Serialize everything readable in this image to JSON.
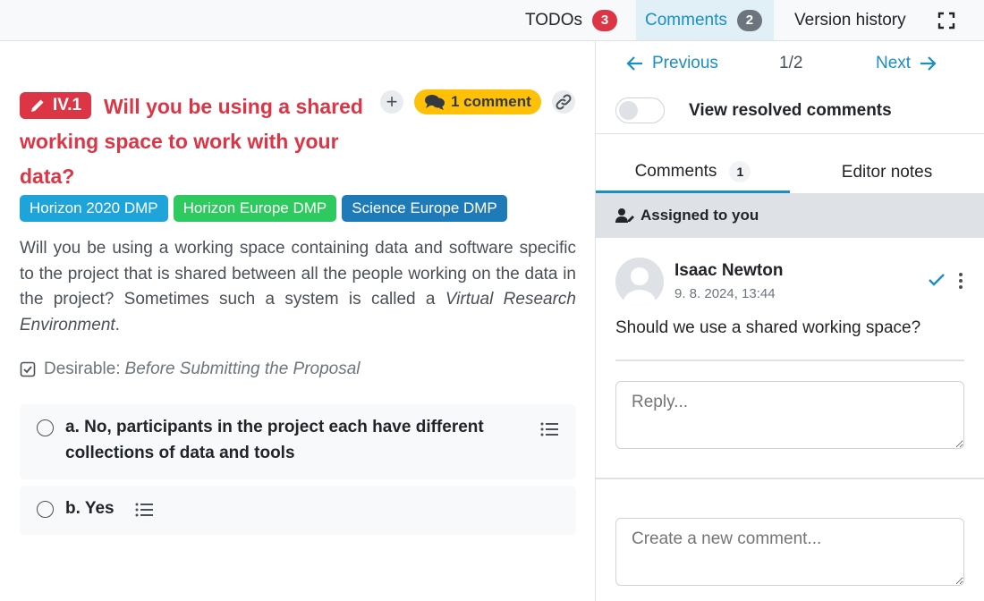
{
  "topbar": {
    "todos_label": "TODOs",
    "todos_count": "3",
    "comments_label": "Comments",
    "comments_count": "2",
    "version_history_label": "Version history",
    "fullscreen_icon": "fullscreen-icon"
  },
  "question": {
    "tag": "IV.1",
    "title": "Will you be using a shared working space to work with your data?",
    "comment_pill": "1 comment",
    "tags": [
      {
        "label": "Horizon 2020 DMP",
        "color": "#1ea4d9"
      },
      {
        "label": "Horizon Europe DMP",
        "color": "#2ec95f"
      },
      {
        "label": "Science Europe DMP",
        "color": "#1f7bb8"
      }
    ],
    "description_main": "Will you be using a working space containing data and software specific to the project that is shared between all the people working on the data in the project? Sometimes such a system is called a ",
    "description_em": "Virtual Research Environment",
    "description_end": ".",
    "desirable_label": "Desirable:",
    "desirable_value": "Before Submitting the Proposal",
    "options": [
      {
        "label": "a. No, participants in the project each have different collections of data and tools"
      },
      {
        "label": "b. Yes"
      }
    ]
  },
  "panel": {
    "previous_label": "Previous",
    "page_count": "1/2",
    "next_label": "Next",
    "view_resolved_label": "View resolved comments",
    "tabs": [
      {
        "label": "Comments",
        "count": "1"
      },
      {
        "label": "Editor notes"
      }
    ],
    "assigned_label": "Assigned to you",
    "comment": {
      "author": "Isaac Newton",
      "time": "9. 8. 2024, 13:44",
      "text": "Should we use a shared working space?"
    },
    "reply_placeholder": "Reply...",
    "new_comment_placeholder": "Create a new comment..."
  },
  "colors": {
    "accent": "#1a8fc3",
    "danger": "#dc3545",
    "warning": "#ffc107"
  }
}
